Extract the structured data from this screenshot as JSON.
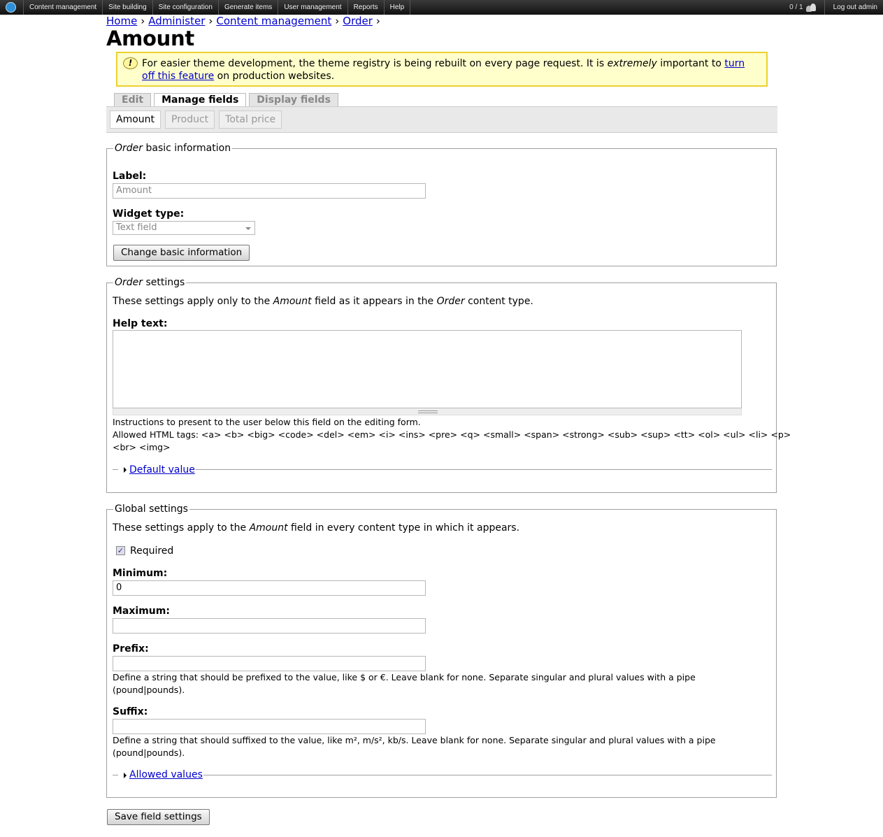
{
  "toolbar": {
    "menu": [
      "Content management",
      "Site building",
      "Site configuration",
      "Generate items",
      "User management",
      "Reports",
      "Help"
    ],
    "user_count": "0 / 1",
    "logout": "Log out admin"
  },
  "breadcrumb": {
    "items": [
      "Home",
      "Administer",
      "Content management",
      "Order"
    ],
    "separator": "›"
  },
  "page_title": "Amount",
  "warning": {
    "icon_text": "!",
    "text_before": "For easier theme development, the theme registry is being rebuilt on every page request. It is ",
    "emphasis": "extremely",
    "text_middle": " important to ",
    "link": "turn off this feature",
    "text_after": " on production websites."
  },
  "tabs_primary": [
    {
      "label": "Edit",
      "active": false
    },
    {
      "label": "Manage fields",
      "active": true
    },
    {
      "label": "Display fields",
      "active": false
    }
  ],
  "tabs_secondary": [
    {
      "label": "Amount",
      "active": true
    },
    {
      "label": "Product",
      "active": false
    },
    {
      "label": "Total price",
      "active": false
    }
  ],
  "basic_info": {
    "legend_em": "Order",
    "legend_rest": " basic information",
    "label_label": "Label:",
    "label_value": "Amount",
    "widget_label": "Widget type:",
    "widget_value": "Text field",
    "button": "Change basic information"
  },
  "order_settings": {
    "legend_em": "Order",
    "legend_rest": " settings",
    "intro_1": "These settings apply only to the ",
    "intro_em1": "Amount",
    "intro_2": " field as it appears in the ",
    "intro_em2": "Order",
    "intro_3": " content type.",
    "help_label": "Help text:",
    "help_value": "",
    "desc_1": "Instructions to present to the user below this field on the editing form.",
    "desc_2": "Allowed HTML tags: <a> <b> <big> <code> <del> <em> <i> <ins> <pre> <q> <small> <span> <strong> <sub> <sup> <tt> <ol> <ul> <li> <p>",
    "desc_3": "<br> <img>",
    "default_value_link": "Default value"
  },
  "global_settings": {
    "legend": "Global settings",
    "intro_1": "These settings apply to the ",
    "intro_em": "Amount",
    "intro_2": " field in every content type in which it appears.",
    "required_label": "Required",
    "required_checked": true,
    "minimum_label": "Minimum:",
    "minimum_value": "0",
    "maximum_label": "Maximum:",
    "maximum_value": "",
    "prefix_label": "Prefix:",
    "prefix_value": "",
    "prefix_desc_1": "Define a string that should be prefixed to the value, like $ or €. Leave blank for none. Separate singular and plural values with a pipe",
    "prefix_desc_2": "(pound|pounds).",
    "suffix_label": "Suffix:",
    "suffix_value": "",
    "suffix_desc_1": "Define a string that should suffixed to the value, like m², m/s², kb/s. Leave blank for none. Separate singular and plural values with a pipe",
    "suffix_desc_2": "(pound|pounds).",
    "allowed_values_link": "Allowed values"
  },
  "save_button": "Save field settings"
}
